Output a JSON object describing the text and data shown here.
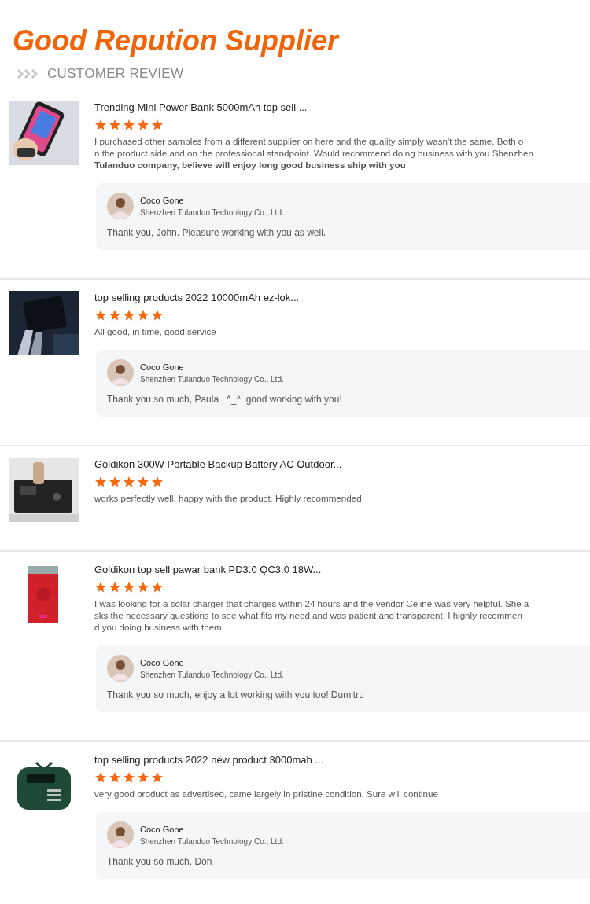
{
  "header": {
    "title": "Good Repution Supplier",
    "subtitle": "CUSTOMER REVIEW"
  },
  "reviews": [
    {
      "product": "Trending Mini Power Bank 5000mAh top sell ...",
      "stars": 5,
      "text_lines": [
        "I purchased other samples from a different supplier on here and the quality simply wasn't the same. Both o",
        "n the product side and on the professional standpoint. Would recommend doing business with you Shenzhen",
        "**Tulanduo company, believe will enjoy long good business ship with you**"
      ],
      "reply": {
        "name": "Coco Gone",
        "company": "Shenzhen Tulanduo Technology Co., Ltd.",
        "text": "Thank you, John. Pleasure working with you as well."
      }
    },
    {
      "product": "top selling products 2022 10000mAh ez-lok...",
      "stars": 5,
      "text_lines": [
        "All good, in time, good service"
      ],
      "reply": {
        "name": "Coco Gone",
        "company": "Shenzhen Tulanduo Technology Co., Ltd.",
        "text": "Thank you so much, Paula   ^_^  good working with you!"
      }
    },
    {
      "product": "Goldikon 300W Portable Backup Battery AC Outdoor...",
      "stars": 5,
      "text_lines": [
        "works perfectly well, happy with the product. Highly recommended"
      ]
    },
    {
      "product": "Goldikon top sell pawar bank PD3.0 QC3.0 18W...",
      "stars": 5,
      "text_lines": [
        "I was looking for a solar charger that charges within 24 hours and the vendor Celine was very helpful. She a",
        "sks the necessary questions to see what fits my need and was patient and transparent. I highly recommen",
        "d you doing business with them."
      ],
      "reply": {
        "name": "Coco Gone",
        "company": "Shenzhen Tulanduo Technology Co., Ltd.",
        "text": "Thank you so much, enjoy a lot working with you too! Dumitru"
      }
    },
    {
      "product": "top selling products 2022 new product 3000mah ...",
      "stars": 5,
      "text_lines": [
        "very good product as advertised, came largely in pristine condition. Sure will continue"
      ],
      "reply": {
        "name": "Coco Gone",
        "company": "Shenzhen Tulanduo Technology Co., Ltd.",
        "text": "Thank you so much, Don"
      }
    }
  ]
}
